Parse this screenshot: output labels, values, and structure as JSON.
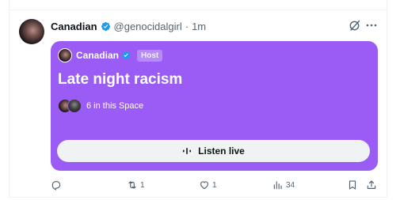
{
  "tweet": {
    "display_name": "Canadian",
    "handle": "@genocidalgirl",
    "separator": "·",
    "time": "1m"
  },
  "space": {
    "host_name": "Canadian",
    "host_badge": "Host",
    "title": "Late night racism",
    "listeners_text": "6 in this Space",
    "listen_button_label": "Listen live",
    "card_color": "#9b5cf5"
  },
  "actions": {
    "reply_count": "",
    "retweet_count": "1",
    "like_count": "1",
    "views_count": "34"
  },
  "icons": {
    "verified": "verified-badge-icon",
    "grok": "grok-icon",
    "more": "more-icon",
    "reply": "reply-icon",
    "retweet": "retweet-icon",
    "like": "heart-icon",
    "views": "views-icon",
    "bookmark": "bookmark-icon",
    "share": "share-icon",
    "listen": "audio-wave-icon"
  },
  "colors": {
    "verified_blue": "#1d9bf0",
    "secondary_text": "#536471"
  }
}
